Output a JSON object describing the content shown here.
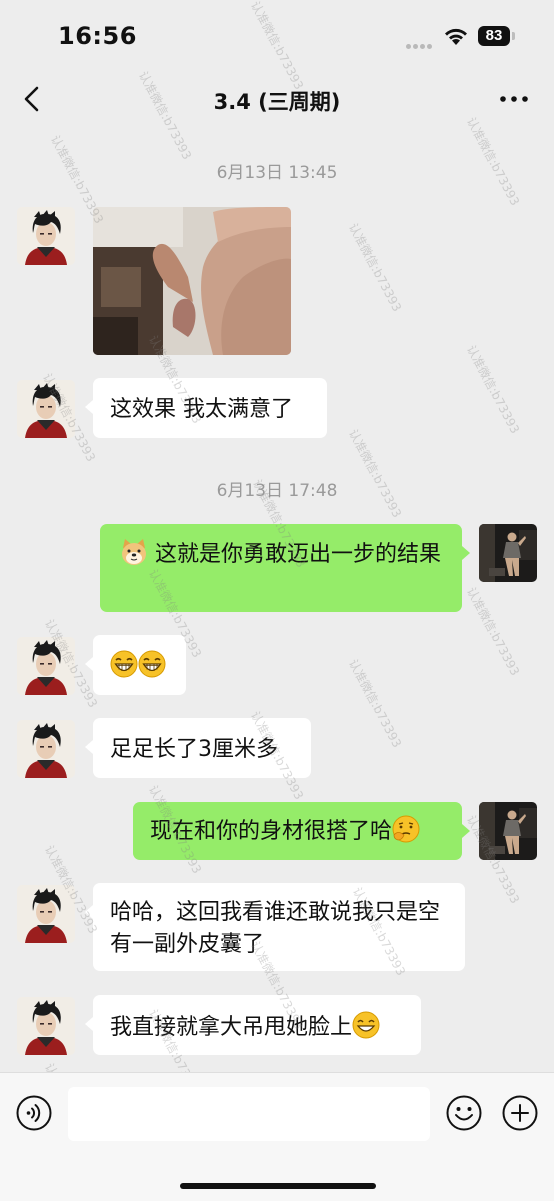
{
  "status_bar": {
    "time": "16:56",
    "battery": "83"
  },
  "header": {
    "title": "3.4 (三周期)"
  },
  "timestamps": [
    "6月13日 13:45",
    "6月13日 17:48"
  ],
  "messages": [
    {
      "side": "in",
      "text": "这效果 我太满意了"
    },
    {
      "side": "out",
      "text": "这就是你勇敢迈出一步的结果"
    },
    {
      "side": "in",
      "text": ""
    },
    {
      "side": "in",
      "text": "足足长了3厘米多"
    },
    {
      "side": "out",
      "text": "现在和你的身材很搭了哈"
    },
    {
      "side": "in",
      "text": "哈哈，这回我看谁还敢说我只是空有一副外皮囊了"
    },
    {
      "side": "in",
      "text": "我直接就拿大吊甩她脸上"
    }
  ],
  "watermark": "认准微信:b73393",
  "colors": {
    "background": "#ededed",
    "outgoing_bubble": "#95ec69",
    "incoming_bubble": "#ffffff",
    "timestamp": "#9a9a9a"
  },
  "icons": [
    "back-chevron-icon",
    "more-icon",
    "wifi-icon",
    "battery-icon",
    "voice-icon",
    "emoji-icon",
    "plus-icon",
    "doge-emoji",
    "grin-emoji",
    "thinking-emoji",
    "laugh-emoji"
  ]
}
